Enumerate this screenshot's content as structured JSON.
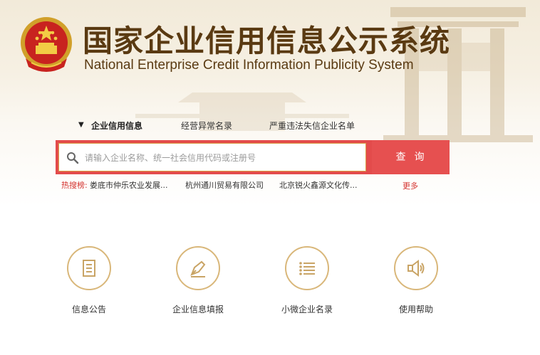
{
  "header": {
    "title_cn": "国家企业信用信息公示系统",
    "title_en": "National Enterprise Credit Information Publicity System",
    "emblem_icon": "national-emblem-icon"
  },
  "tabs": [
    {
      "label": "企业信用信息",
      "active": true
    },
    {
      "label": "经营异常名录",
      "active": false
    },
    {
      "label": "严重违法失信企业名单",
      "active": false
    }
  ],
  "search": {
    "placeholder": "请输入企业名称、统一社会信用代码或注册号",
    "button_label": "查询"
  },
  "hot_search": {
    "label": "热搜榜:",
    "items": [
      "娄底市仲乐农业发展...",
      "杭州通川贸易有限公司",
      "北京锐火鑫源文化传..."
    ],
    "more_label": "更多"
  },
  "features": [
    {
      "label": "信息公告",
      "icon": "document-icon"
    },
    {
      "label": "企业信息填报",
      "icon": "pen-icon"
    },
    {
      "label": "小微企业名录",
      "icon": "list-icon"
    },
    {
      "label": "使用帮助",
      "icon": "speaker-icon"
    }
  ],
  "colors": {
    "brand_brown": "#5a3a12",
    "search_red": "#e65050",
    "hot_red": "#d4332f",
    "gold": "#d9b77a"
  }
}
